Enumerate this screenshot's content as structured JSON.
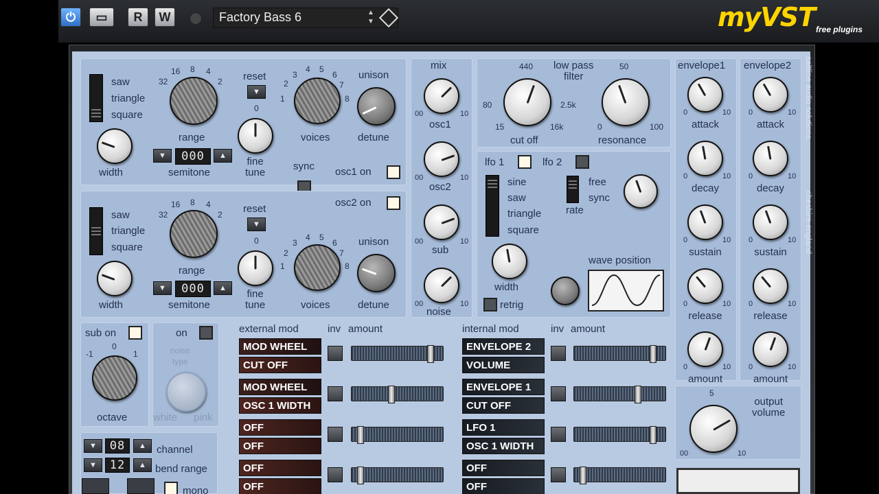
{
  "host": {
    "preset_name": "Factory Bass 6",
    "buttons": {
      "power": "⏻",
      "minimize": "▭",
      "read": "R",
      "write": "W"
    },
    "logo": {
      "main": "myVST",
      "sub": "free plugins"
    }
  },
  "osc1": {
    "waves": [
      "saw",
      "triangle",
      "square"
    ],
    "width": "width",
    "range_ticks": [
      "32",
      "16",
      "8",
      "4",
      "2"
    ],
    "range": "range",
    "semitone": "semitone",
    "semitone_value": "000",
    "reset": "reset",
    "fine_zero": "0",
    "fine_tune": "fine\ntune",
    "voices_ticks": [
      "2",
      "3",
      "4",
      "5",
      "6",
      "7",
      "8",
      "1"
    ],
    "voices": "voices",
    "unison": "unison",
    "detune": "detune",
    "on": "osc1 on"
  },
  "sync": "sync",
  "osc2": {
    "on": "osc2 on",
    "waves": [
      "saw",
      "triangle",
      "square"
    ],
    "width": "width",
    "range_ticks": [
      "32",
      "16",
      "8",
      "4",
      "2"
    ],
    "range": "range",
    "semitone": "semitone",
    "semitone_value": "000",
    "reset": "reset",
    "fine_zero": "0",
    "fine_tune": "fine\ntune",
    "voices_ticks": [
      "2",
      "3",
      "4",
      "5",
      "6",
      "7",
      "8",
      "1"
    ],
    "voices": "voices",
    "unison": "unison",
    "detune": "detune"
  },
  "mix": {
    "title": "mix",
    "channels": [
      {
        "label": "osc1",
        "min": "00",
        "max": "10"
      },
      {
        "label": "osc2",
        "min": "00",
        "max": "10"
      },
      {
        "label": "sub",
        "min": "00",
        "max": "10"
      },
      {
        "label": "noise",
        "min": "00",
        "max": "10"
      }
    ]
  },
  "filter": {
    "title": "low pass\nfilter",
    "cutoff_ticks": [
      "440",
      "80",
      "2.5k",
      "15",
      "16k"
    ],
    "cutoff": "cut off",
    "res_ticks": [
      "50",
      "0",
      "100"
    ],
    "resonance": "resonance"
  },
  "lfo": {
    "lfo1": "lfo 1",
    "lfo2": "lfo 2",
    "waves": [
      "sine",
      "saw",
      "triangle",
      "square"
    ],
    "rate_modes": [
      "free",
      "sync"
    ],
    "rate": "rate",
    "width": "width",
    "retrig": "retrig",
    "wave_position": "wave position"
  },
  "env1": {
    "title": "envelope1",
    "knobs": [
      "attack",
      "decay",
      "sustain",
      "release",
      "amount"
    ]
  },
  "env2": {
    "title": "envelope2",
    "knobs": [
      "attack",
      "decay",
      "sustain",
      "release",
      "amount"
    ]
  },
  "env_scale": {
    "min": "0",
    "max": "10"
  },
  "side_text": {
    "brand": "saltline audio solutions",
    "place": "cheshire-england"
  },
  "sub": {
    "on": "sub on",
    "ticks": [
      "0",
      "-1",
      "1"
    ],
    "octave": "octave"
  },
  "noise": {
    "on": "on",
    "type": "noise\ntype",
    "white": "white",
    "pink": "pink"
  },
  "ext_mod": {
    "title": "external mod",
    "inv": "inv",
    "amount": "amount",
    "rows": [
      {
        "src": "MOD WHEEL",
        "dst": "CUT OFF",
        "pos": 0.88
      },
      {
        "src": "MOD WHEEL",
        "dst": "OSC 1 WIDTH",
        "pos": 0.42
      },
      {
        "src": "OFF",
        "dst": "OFF",
        "pos": 0.06
      },
      {
        "src": "OFF",
        "dst": "OFF",
        "pos": 0.06
      }
    ]
  },
  "int_mod": {
    "title": "internal mod",
    "inv": "inv",
    "amount": "amount",
    "rows": [
      {
        "src": "ENVELOPE 2",
        "dst": "VOLUME",
        "pos": 0.88
      },
      {
        "src": "ENVELOPE 1",
        "dst": "CUT OFF",
        "pos": 0.7
      },
      {
        "src": "LFO 1",
        "dst": "OSC 1 WIDTH",
        "pos": 0.88
      },
      {
        "src": "OFF",
        "dst": "OFF",
        "pos": 0.06
      }
    ]
  },
  "midi": {
    "channel_value": "08",
    "channel": "channel",
    "bend_value": "12",
    "bend_range": "bend range",
    "mono": "mono"
  },
  "output": {
    "tick_top": "5",
    "min": "00",
    "max": "10",
    "label": "output\nvolume"
  }
}
